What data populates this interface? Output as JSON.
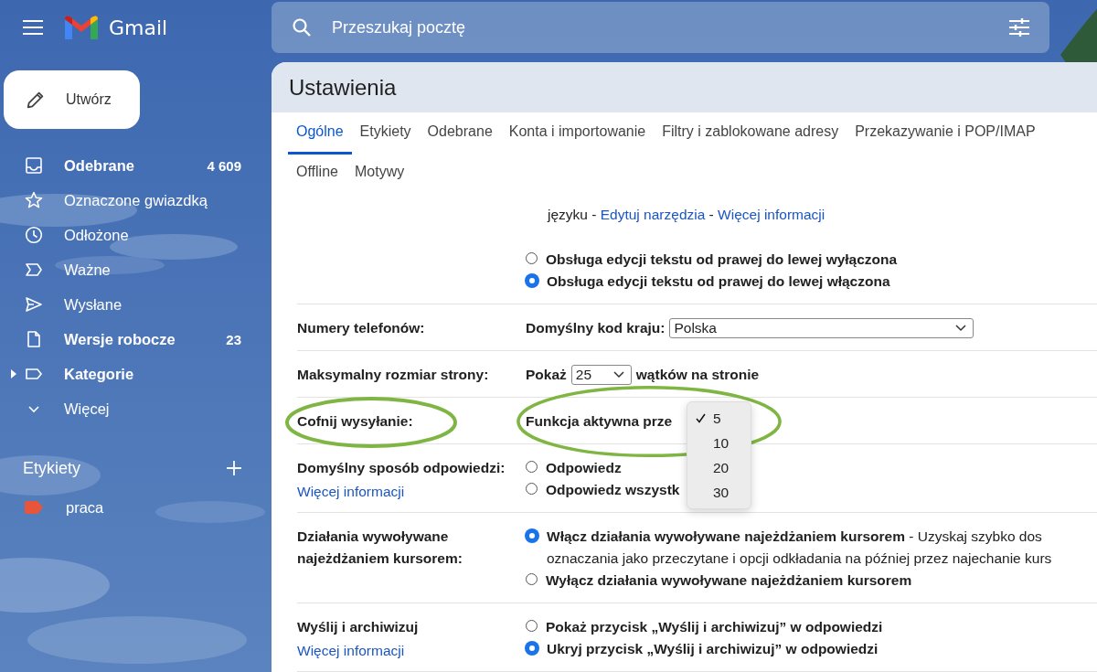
{
  "app": {
    "name": "Gmail"
  },
  "search": {
    "placeholder": "Przeszukaj pocztę"
  },
  "sidebar": {
    "compose": "Utwórz",
    "items": [
      {
        "label": "Odebrane",
        "count": "4 609",
        "bold": true,
        "kind": "folder"
      },
      {
        "label": "Oznaczone gwiazdką",
        "bold": false,
        "kind": "folder"
      },
      {
        "label": "Odłożone",
        "bold": false,
        "kind": "folder"
      },
      {
        "label": "Ważne",
        "bold": false,
        "kind": "folder"
      },
      {
        "label": "Wysłane",
        "bold": false,
        "kind": "folder"
      },
      {
        "label": "Wersje robocze",
        "count": "23",
        "bold": true,
        "kind": "folder"
      },
      {
        "label": "Kategorie",
        "bold": true,
        "kind": "category"
      },
      {
        "label": "Więcej",
        "bold": false,
        "kind": "more"
      }
    ],
    "labels_title": "Etykiety",
    "labels": [
      {
        "name": "praca",
        "color": "#e8553b"
      }
    ]
  },
  "settings": {
    "title": "Ustawienia",
    "tab_rows": [
      [
        {
          "label": "Ogólne",
          "selected": true
        },
        {
          "label": "Etykiety",
          "selected": false
        },
        {
          "label": "Odebrane",
          "selected": false
        },
        {
          "label": "Konta i importowanie",
          "selected": false
        },
        {
          "label": "Filtry i zablokowane adresy",
          "selected": false
        },
        {
          "label": "Przekazywanie i POP/IMAP",
          "selected": false
        }
      ],
      [
        {
          "label": "Offline",
          "selected": false
        },
        {
          "label": "Motywy",
          "selected": false
        }
      ]
    ],
    "rows": [
      {
        "items": [
          {
            "kind": "links",
            "parts": [
              {
                "text": "języku - "
              },
              {
                "link": "Edytuj narzędzia"
              },
              {
                "text": " - "
              },
              {
                "link": "Więcej informacji"
              }
            ]
          },
          {
            "kind": "radio",
            "label": "Obsługa edycji tekstu od prawej do lewej wyłączona",
            "selected": false
          },
          {
            "kind": "radio",
            "label": "Obsługa edycji tekstu od prawej do lewej włączona",
            "selected": true
          }
        ]
      },
      {
        "label": "Numery telefonów:",
        "items": [
          {
            "kind": "select",
            "prefix": "Domyślny kod kraju:",
            "value": "Polska",
            "wide": true
          }
        ]
      },
      {
        "label": "Maksymalny rozmiar strony:",
        "items": [
          {
            "kind": "select",
            "prefix": "Pokaż",
            "value": "25",
            "suffix": "wątków na stronie",
            "wide": false
          }
        ]
      },
      {
        "label": "Cofnij wysyłanie:",
        "annotated": true,
        "items": [
          {
            "kind": "popup",
            "prefix": "Funkcja aktywna prze",
            "options": [
              {
                "label": "5",
                "selected": true
              },
              {
                "label": "10",
                "selected": false
              },
              {
                "label": "20",
                "selected": false
              },
              {
                "label": "30",
                "selected": false
              }
            ]
          }
        ]
      },
      {
        "label": "Domyślny sposób odpowiedzi:",
        "link": "Więcej informacji",
        "items": [
          {
            "kind": "radio",
            "label": "Odpowiedz",
            "selected": false
          },
          {
            "kind": "radio",
            "label": "Odpowiedz wszystk",
            "selected": false
          }
        ]
      },
      {
        "label": "Działania wywoływane najeżdżaniem kursorem:",
        "items": [
          {
            "kind": "radio",
            "label": "Włącz działania wywoływane najeżdżaniem kursorem",
            "description": "- Uzyskaj szybko dos",
            "continuation": "oznaczania jako przeczytane i opcji odkładania na później przez najechanie kurs",
            "selected": true
          },
          {
            "kind": "radio",
            "label": "Wyłącz działania wywoływane najeżdżaniem kursorem",
            "selected": false
          }
        ]
      },
      {
        "label": "Wyślij i archiwizuj",
        "link": "Więcej informacji",
        "items": [
          {
            "kind": "radio",
            "label": "Pokaż przycisk „Wyślij i archiwizuj” w odpowiedzi",
            "selected": false
          },
          {
            "kind": "radio",
            "label": "Ukryj przycisk „Wyślij i archiwizuj” w odpowiedzi",
            "selected": true
          }
        ]
      }
    ]
  }
}
